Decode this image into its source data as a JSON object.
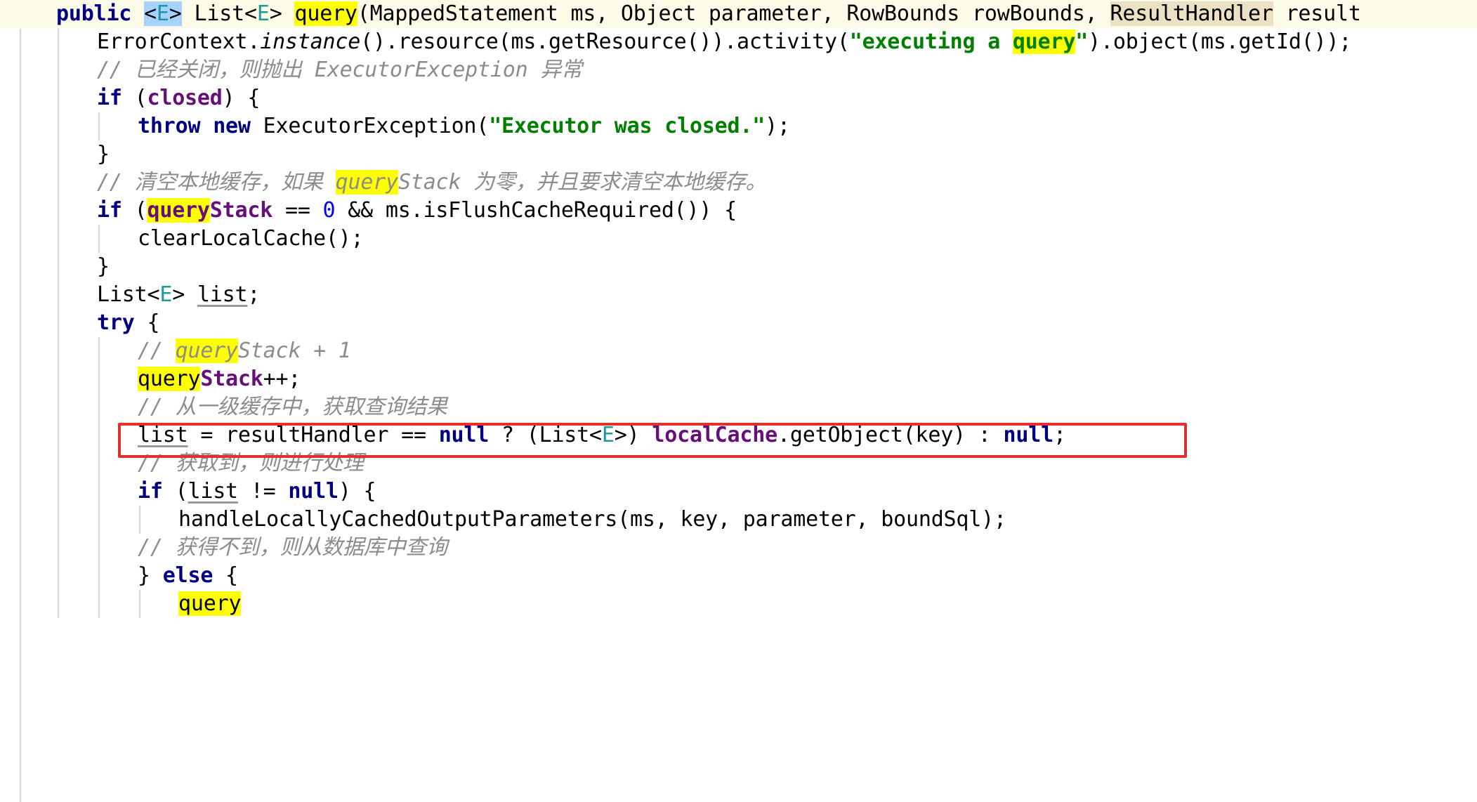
{
  "editor": {
    "language": "java",
    "theme": "light",
    "search_highlight_term": "query",
    "colors": {
      "keyword": "#000080",
      "field": "#660e7a",
      "generic_type": "#20999d",
      "string": "#008000",
      "number": "#0000ff",
      "comment": "#8c8c8c",
      "search_highlight": "#ffff00",
      "identifier_highlight": "#ece1c4",
      "selection": "#a6d2ff",
      "caret_line": "#fcfbe8",
      "annotation_box": "#e03030",
      "indent_guide": "#d8d8d8"
    }
  },
  "code": {
    "lines": [
      {
        "id": "line-1",
        "indent": 0,
        "caret_line": true,
        "tokens": [
          {
            "t": "public",
            "c": "kw"
          },
          {
            "t": " ",
            "c": "plain"
          },
          {
            "t": "<",
            "c": "plain",
            "sel": true
          },
          {
            "t": "E",
            "c": "generic",
            "sel": true
          },
          {
            "t": ">",
            "c": "plain",
            "sel": true
          },
          {
            "t": " List",
            "c": "plain"
          },
          {
            "t": "<",
            "c": "plain"
          },
          {
            "t": "E",
            "c": "generic"
          },
          {
            "t": ">",
            "c": "plain"
          },
          {
            "t": " ",
            "c": "plain"
          },
          {
            "t": "CARET",
            "c": "caret"
          },
          {
            "t": "query",
            "c": "plain",
            "hl": true
          },
          {
            "t": "(MappedStatement ms, Object parameter, RowBounds rowBounds, ",
            "c": "plain"
          },
          {
            "t": "ResultHandler",
            "c": "plain",
            "idhl": true
          },
          {
            "t": " result",
            "c": "plain"
          }
        ]
      },
      {
        "id": "line-2",
        "indent": 1,
        "caret_line": false,
        "tokens": [
          {
            "t": "ErrorContext.",
            "c": "plain"
          },
          {
            "t": "instance",
            "c": "cmt-italic-plain"
          },
          {
            "t": "().resource(ms.getResource()).activity(",
            "c": "plain"
          },
          {
            "t": "\"executing a ",
            "c": "str"
          },
          {
            "t": "query",
            "c": "str",
            "hl": true
          },
          {
            "t": "\"",
            "c": "str"
          },
          {
            "t": ").object(ms.getId());",
            "c": "plain"
          }
        ]
      },
      {
        "id": "line-3",
        "indent": 1,
        "caret_line": false,
        "tokens": [
          {
            "t": "// 已经关闭，则抛出 ExecutorException 异常",
            "c": "cmt"
          }
        ]
      },
      {
        "id": "line-4",
        "indent": 1,
        "caret_line": false,
        "tokens": [
          {
            "t": "if",
            "c": "kw"
          },
          {
            "t": " (",
            "c": "plain"
          },
          {
            "t": "closed",
            "c": "field"
          },
          {
            "t": ") {",
            "c": "plain"
          }
        ]
      },
      {
        "id": "line-5",
        "indent": 2,
        "caret_line": false,
        "tokens": [
          {
            "t": "throw",
            "c": "kw"
          },
          {
            "t": " ",
            "c": "plain"
          },
          {
            "t": "new",
            "c": "kw"
          },
          {
            "t": " ExecutorException(",
            "c": "plain"
          },
          {
            "t": "\"Executor was closed.\"",
            "c": "str"
          },
          {
            "t": ");",
            "c": "plain"
          }
        ]
      },
      {
        "id": "line-6",
        "indent": 1,
        "caret_line": false,
        "tokens": [
          {
            "t": "}",
            "c": "plain"
          }
        ]
      },
      {
        "id": "line-7",
        "indent": 1,
        "caret_line": false,
        "tokens": [
          {
            "t": "// 清空本地缓存，如果 ",
            "c": "cmt"
          },
          {
            "t": "query",
            "c": "cmt",
            "hl": true
          },
          {
            "t": "Stack 为零，并且要求清空本地缓存。",
            "c": "cmt"
          }
        ]
      },
      {
        "id": "line-8",
        "indent": 1,
        "caret_line": false,
        "tokens": [
          {
            "t": "if",
            "c": "kw"
          },
          {
            "t": " (",
            "c": "plain"
          },
          {
            "t": "query",
            "c": "field",
            "hl": true
          },
          {
            "t": "Stack",
            "c": "field"
          },
          {
            "t": " == ",
            "c": "plain"
          },
          {
            "t": "0",
            "c": "num"
          },
          {
            "t": " && ms.isFlushCacheRequired()) {",
            "c": "plain"
          }
        ]
      },
      {
        "id": "line-9",
        "indent": 2,
        "caret_line": false,
        "tokens": [
          {
            "t": "clearLocalCache();",
            "c": "plain"
          }
        ]
      },
      {
        "id": "line-10",
        "indent": 1,
        "caret_line": false,
        "tokens": [
          {
            "t": "}",
            "c": "plain"
          }
        ]
      },
      {
        "id": "line-11",
        "indent": 1,
        "caret_line": false,
        "tokens": [
          {
            "t": "List",
            "c": "plain"
          },
          {
            "t": "<",
            "c": "plain"
          },
          {
            "t": "E",
            "c": "generic"
          },
          {
            "t": "> ",
            "c": "plain"
          },
          {
            "t": "list",
            "c": "plain",
            "ul": true
          },
          {
            "t": ";",
            "c": "plain"
          }
        ]
      },
      {
        "id": "line-12",
        "indent": 1,
        "caret_line": false,
        "tokens": [
          {
            "t": "try",
            "c": "kw"
          },
          {
            "t": " {",
            "c": "plain"
          }
        ]
      },
      {
        "id": "line-13",
        "indent": 2,
        "caret_line": false,
        "tokens": [
          {
            "t": "// ",
            "c": "cmt"
          },
          {
            "t": "query",
            "c": "cmt",
            "hl": true
          },
          {
            "t": "Stack + 1",
            "c": "cmt"
          }
        ]
      },
      {
        "id": "line-14",
        "indent": 2,
        "caret_line": false,
        "tokens": [
          {
            "t": "query",
            "c": "plain",
            "hl": true
          },
          {
            "t": "Stack",
            "c": "field"
          },
          {
            "t": "++;",
            "c": "plain"
          }
        ]
      },
      {
        "id": "line-15",
        "indent": 2,
        "caret_line": false,
        "tokens": [
          {
            "t": "// 从一级缓存中，获取查询结果",
            "c": "cmt"
          }
        ]
      },
      {
        "id": "line-16",
        "indent": 2,
        "caret_line": false,
        "boxed": true,
        "tokens": [
          {
            "t": "list",
            "c": "plain",
            "ul": true
          },
          {
            "t": " = resultHandler == ",
            "c": "plain"
          },
          {
            "t": "null",
            "c": "kw"
          },
          {
            "t": " ? (List<",
            "c": "plain"
          },
          {
            "t": "E",
            "c": "generic"
          },
          {
            "t": ">) ",
            "c": "plain"
          },
          {
            "t": "localCache",
            "c": "field"
          },
          {
            "t": ".getObject(key) : ",
            "c": "plain"
          },
          {
            "t": "null",
            "c": "kw"
          },
          {
            "t": ";",
            "c": "plain"
          }
        ]
      },
      {
        "id": "line-17",
        "indent": 2,
        "caret_line": false,
        "tokens": [
          {
            "t": "// 获取到，则进行处理",
            "c": "cmt"
          }
        ]
      },
      {
        "id": "line-18",
        "indent": 2,
        "caret_line": false,
        "tokens": [
          {
            "t": "if",
            "c": "kw"
          },
          {
            "t": " (",
            "c": "plain"
          },
          {
            "t": "list",
            "c": "plain",
            "ul": true
          },
          {
            "t": " != ",
            "c": "plain"
          },
          {
            "t": "null",
            "c": "kw"
          },
          {
            "t": ") {",
            "c": "plain"
          }
        ]
      },
      {
        "id": "line-19",
        "indent": 3,
        "caret_line": false,
        "tokens": [
          {
            "t": "handleLocallyCachedOutputParameters(ms, key, parameter, boundSql);",
            "c": "plain"
          }
        ]
      },
      {
        "id": "line-20",
        "indent": 2,
        "caret_line": false,
        "tokens": [
          {
            "t": "// 获得不到，则从数据库中查询",
            "c": "cmt"
          }
        ]
      },
      {
        "id": "line-21",
        "indent": 2,
        "caret_line": false,
        "tokens": [
          {
            "t": "} ",
            "c": "plain"
          },
          {
            "t": "else",
            "c": "kw"
          },
          {
            "t": " {",
            "c": "plain"
          }
        ]
      },
      {
        "id": "line-22",
        "indent": 3,
        "caret_line": false,
        "partial": true,
        "tokens": [
          {
            "t": "query",
            "c": "plain",
            "hl": true
          }
        ]
      }
    ]
  },
  "annotation": {
    "type": "red-rectangle",
    "target_line_id": "line-16",
    "label": "list = resultHandler == null ? (List<E>) localCache.getObject(key) : null;"
  }
}
